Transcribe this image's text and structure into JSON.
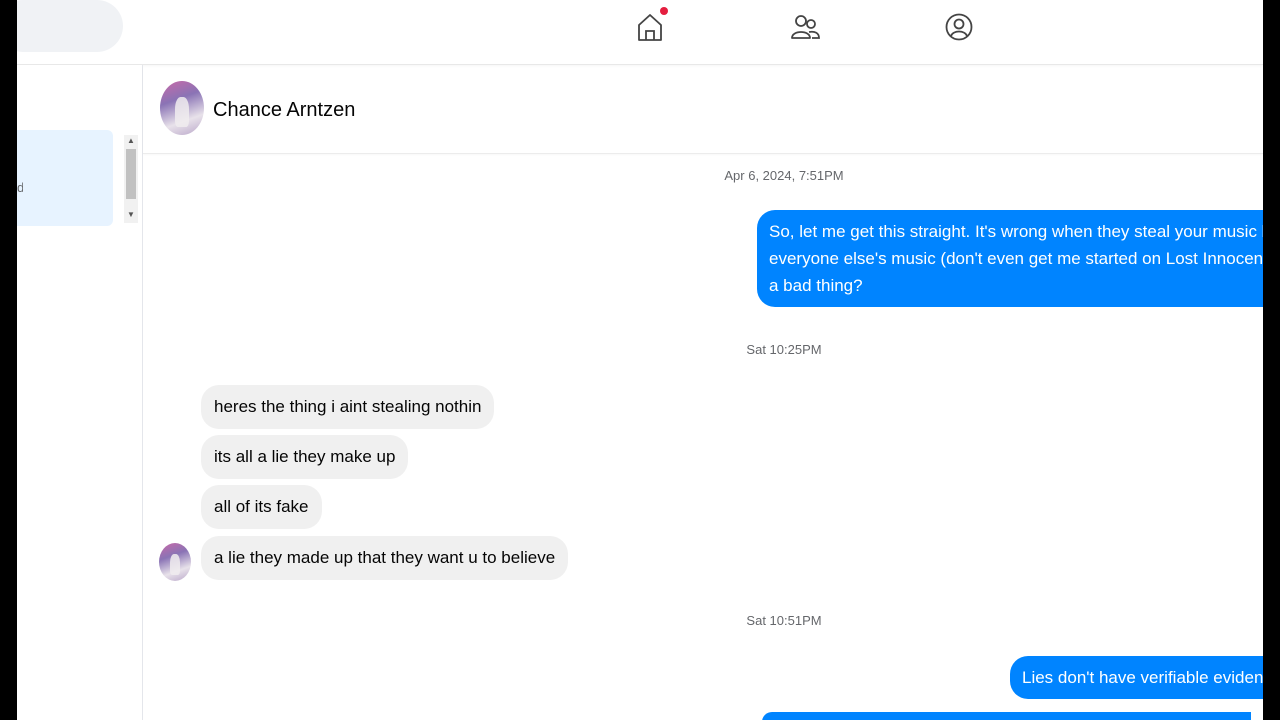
{
  "nav": {
    "icons": [
      "home-icon",
      "friends-icon",
      "profile-icon"
    ],
    "home_has_notification": true
  },
  "sidebar": {
    "active_item_label": "d"
  },
  "chat": {
    "contact_name": "Chance Arntzen",
    "messages": [
      {
        "type": "timestamp",
        "text": "Apr 6, 2024, 7:51PM"
      },
      {
        "type": "outgoing",
        "lines": [
          "So, let me get this straight. It's wrong when they steal your music b",
          "everyone else's music (don't even get me started on Lost Innocenc",
          "a bad thing?"
        ]
      },
      {
        "type": "timestamp",
        "text": "Sat 10:25PM"
      },
      {
        "type": "incoming",
        "text": "heres the thing i aint stealing nothin"
      },
      {
        "type": "incoming",
        "text": "its all a lie they make up"
      },
      {
        "type": "incoming",
        "text": "all of its fake"
      },
      {
        "type": "incoming",
        "text": "a lie they made up that they want u to believe"
      },
      {
        "type": "timestamp",
        "text": "Sat 10:51PM"
      },
      {
        "type": "outgoing",
        "lines": [
          "Lies don't have verifiable evidenc"
        ]
      }
    ]
  },
  "colors": {
    "outgoing_bubble": "#0084ff",
    "incoming_bubble": "#f0f0f0",
    "notification_dot": "#e41e3f",
    "active_sidebar": "#e7f3ff"
  }
}
